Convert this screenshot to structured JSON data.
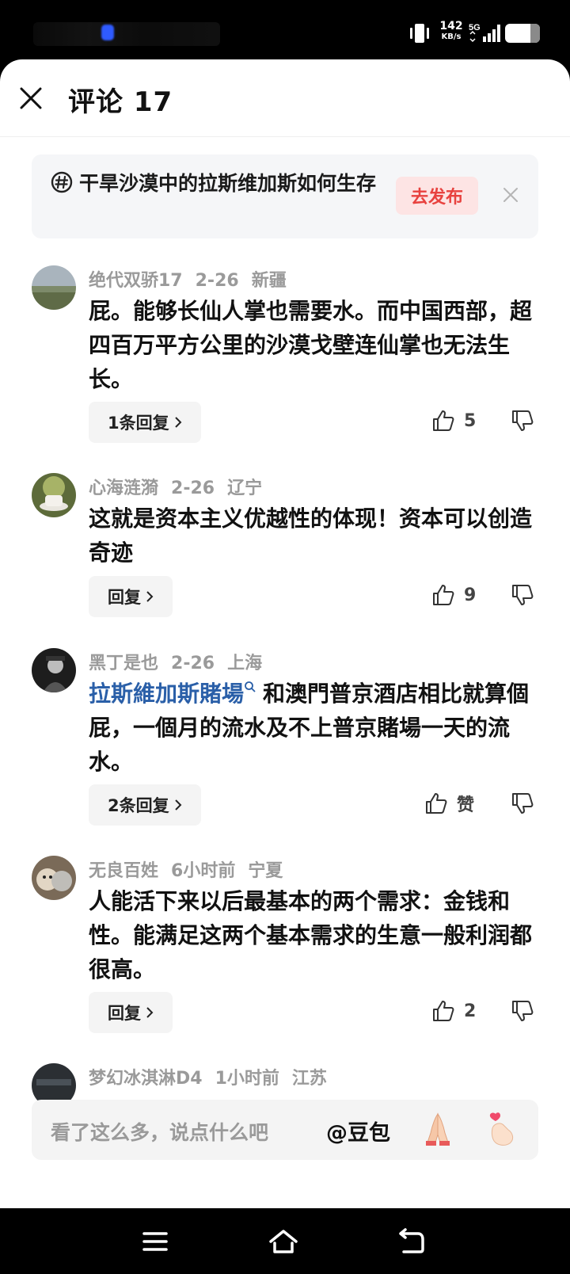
{
  "status": {
    "speed_value": "142",
    "speed_unit": "KB/s",
    "network": "5G"
  },
  "header": {
    "title": "评论 17"
  },
  "topic": {
    "text": "干旱沙漠中的拉斯维加斯如何生存",
    "publish_label": "去发布"
  },
  "comments": [
    {
      "user": "绝代双骄17",
      "date": "2-26",
      "location": "新疆",
      "text": "屁。能够长仙人掌也需要水。而中国西部，超四百万平方公里的沙漠戈壁连仙掌也无法生长。",
      "reply_label": "1条回复",
      "likes": "5"
    },
    {
      "user": "心海涟漪",
      "date": "2-26",
      "location": "辽宁",
      "text": "这就是资本主义优越性的体现！资本可以创造奇迹",
      "reply_label": "回复",
      "likes": "9"
    },
    {
      "user": "黑丁是也",
      "date": "2-26",
      "location": "上海",
      "link": "拉斯維加斯賭場",
      "text": "和澳門普京酒店相比就算個屁，一個月的流水及不上普京賭場一天的流水。",
      "reply_label": "2条回复",
      "likes": "赞"
    },
    {
      "user": "无良百姓",
      "date": "6小时前",
      "location": "宁夏",
      "text": "人能活下来以后最基本的两个需求：金钱和性。能满足这两个基本需求的生意一般利润都很高。",
      "reply_label": "回复",
      "likes": "2"
    },
    {
      "user": "梦幻冰淇淋D4",
      "date": "1小时前",
      "location": "江苏"
    }
  ],
  "bottom": {
    "placeholder": "看了这么多，说点什么吧",
    "mention": "@豆包"
  },
  "colors": {
    "accent_red": "#e8423f",
    "link_blue": "#2a5fa8"
  }
}
